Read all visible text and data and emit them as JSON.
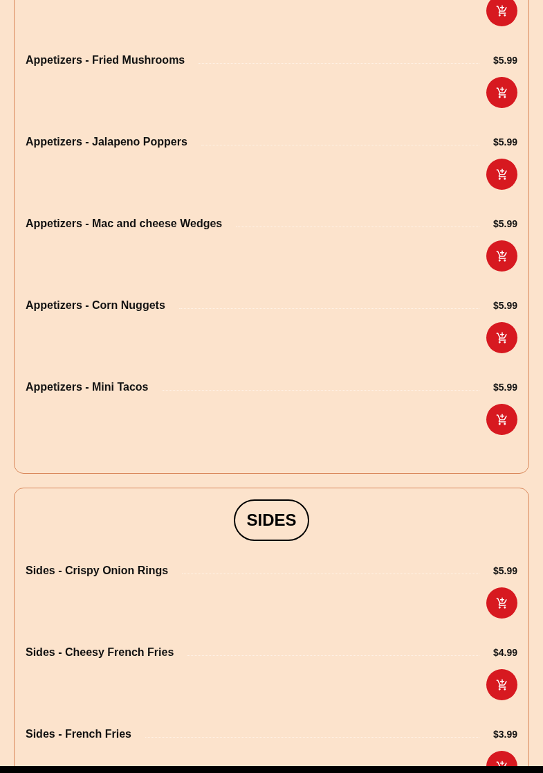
{
  "sections": [
    {
      "items": [
        {
          "kind": "partial"
        },
        {
          "kind": "full",
          "name": "Appetizers - Fried Mushrooms",
          "price": "$5.99"
        },
        {
          "kind": "full",
          "name": "Appetizers - Jalapeno Poppers",
          "price": "$5.99"
        },
        {
          "kind": "full",
          "name": "Appetizers - Mac and cheese Wedges",
          "price": "$5.99"
        },
        {
          "kind": "full",
          "name": "Appetizers - Corn Nuggets",
          "price": "$5.99"
        },
        {
          "kind": "full",
          "name": "Appetizers - Mini Tacos",
          "price": "$5.99"
        }
      ]
    },
    {
      "title": "SIDES",
      "items": [
        {
          "kind": "full",
          "name": "Sides - Crispy Onion Rings",
          "price": "$5.99"
        },
        {
          "kind": "full",
          "name": "Sides - Cheesy French Fries",
          "price": "$4.99"
        },
        {
          "kind": "full",
          "name": "Sides - French Fries",
          "price": "$3.99"
        }
      ]
    }
  ]
}
